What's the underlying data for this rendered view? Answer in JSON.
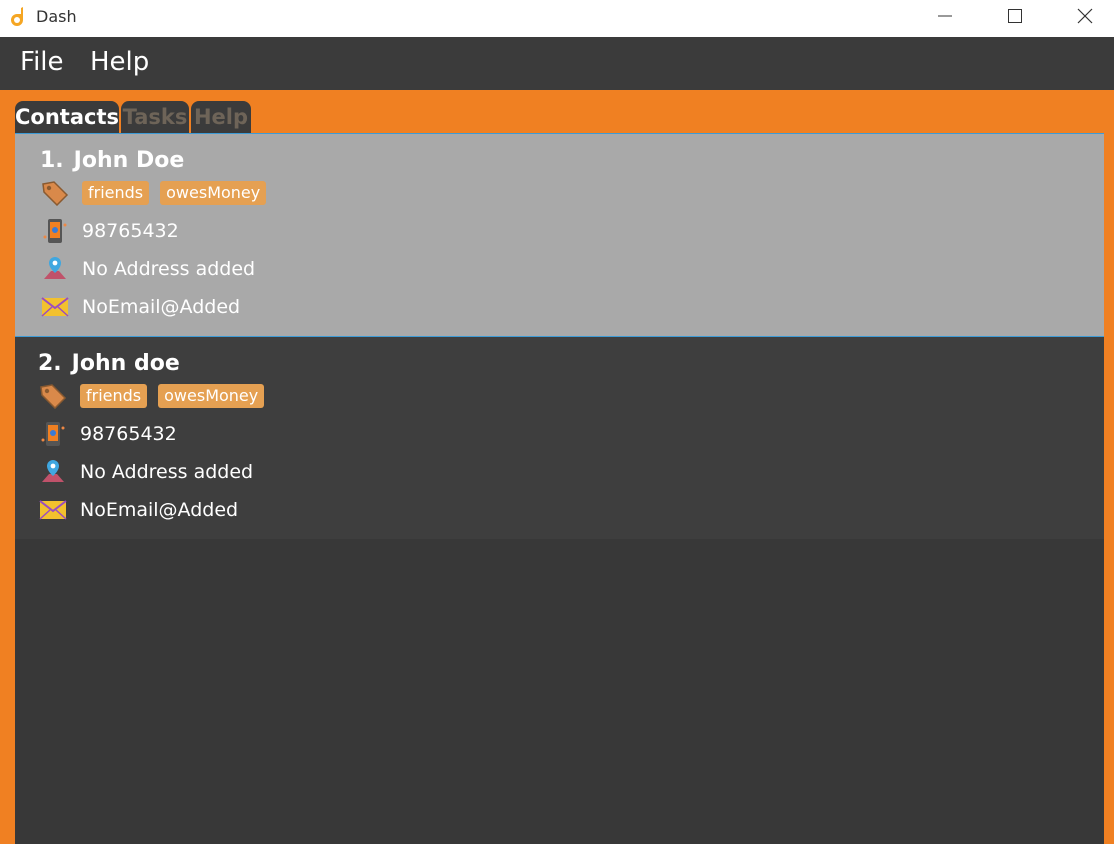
{
  "window": {
    "title": "Dash"
  },
  "menu": {
    "items": [
      "File",
      "Help"
    ]
  },
  "tabs": [
    {
      "label": "Contacts",
      "active": true
    },
    {
      "label": "Tasks",
      "active": false
    },
    {
      "label": "Help",
      "active": false
    }
  ],
  "contacts": [
    {
      "index": "1.",
      "name": "John Doe",
      "tags": [
        "friends",
        "owesMoney"
      ],
      "phone": "98765432",
      "address": "No Address added",
      "email": "NoEmail@Added",
      "selected": true
    },
    {
      "index": "2.",
      "name": "John doe",
      "tags": [
        "friends",
        "owesMoney"
      ],
      "phone": "98765432",
      "address": "No Address added",
      "email": "NoEmail@Added",
      "selected": false
    }
  ],
  "colors": {
    "accent": "#f08022",
    "dark": "#3b3b3b",
    "tag": "#e5a052",
    "selected_card": "#a9a9a9"
  }
}
